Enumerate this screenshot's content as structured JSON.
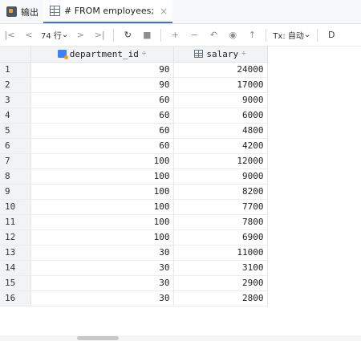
{
  "tabs": [
    {
      "label": "输出",
      "icon": "output-icon",
      "active": false
    },
    {
      "label": "# FROM employees;",
      "icon": "table-icon",
      "active": true,
      "close": "×"
    }
  ],
  "toolbar": {
    "first": "|<",
    "prev": "<",
    "rows_label": "74 行",
    "rows_dropdown": "⌄",
    "next": ">",
    "last": ">|",
    "refresh": "↻",
    "stop": "■",
    "add": "+",
    "remove": "−",
    "revert": "↶",
    "preview": "◉",
    "submit": "↑",
    "tx_label": "Tx: 自动",
    "tx_dropdown": "⌄",
    "cut": "D"
  },
  "grid": {
    "columns": [
      {
        "label": "department_id",
        "icon": "key-icon",
        "sort": "÷"
      },
      {
        "label": "salary",
        "icon": "grid-icon",
        "sort": "÷"
      }
    ],
    "rows": [
      {
        "n": "1",
        "department_id": "90",
        "salary": "24000"
      },
      {
        "n": "2",
        "department_id": "90",
        "salary": "17000"
      },
      {
        "n": "3",
        "department_id": "60",
        "salary": "9000"
      },
      {
        "n": "4",
        "department_id": "60",
        "salary": "6000"
      },
      {
        "n": "5",
        "department_id": "60",
        "salary": "4800"
      },
      {
        "n": "6",
        "department_id": "60",
        "salary": "4200"
      },
      {
        "n": "7",
        "department_id": "100",
        "salary": "12000"
      },
      {
        "n": "8",
        "department_id": "100",
        "salary": "9000"
      },
      {
        "n": "9",
        "department_id": "100",
        "salary": "8200"
      },
      {
        "n": "10",
        "department_id": "100",
        "salary": "7700"
      },
      {
        "n": "11",
        "department_id": "100",
        "salary": "7800"
      },
      {
        "n": "12",
        "department_id": "100",
        "salary": "6900"
      },
      {
        "n": "13",
        "department_id": "30",
        "salary": "11000"
      },
      {
        "n": "14",
        "department_id": "30",
        "salary": "3100"
      },
      {
        "n": "15",
        "department_id": "30",
        "salary": "2900"
      },
      {
        "n": "16",
        "department_id": "30",
        "salary": "2800"
      }
    ]
  }
}
